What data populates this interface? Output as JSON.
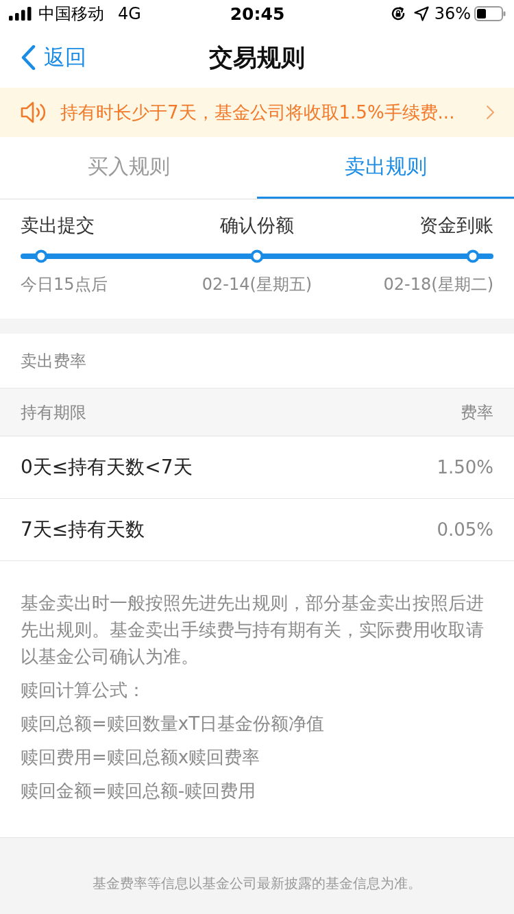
{
  "status_bar": {
    "carrier": "中国移动",
    "network": "4G",
    "time": "20:45",
    "battery": "36%"
  },
  "nav": {
    "back": "返回",
    "title": "交易规则"
  },
  "notice": {
    "text": "持有时长少于7天，基金公司将收取1.5%手续费..."
  },
  "tabs": [
    {
      "label": "买入规则",
      "selected": false
    },
    {
      "label": "卖出规则",
      "selected": true
    }
  ],
  "timeline": {
    "steps": [
      {
        "label": "卖出提交",
        "date": "今日15点后"
      },
      {
        "label": "确认份额",
        "date": "02-14(星期五)"
      },
      {
        "label": "资金到账",
        "date": "02-18(星期二)"
      }
    ]
  },
  "fee_section": {
    "title": "卖出费率",
    "columns": [
      "持有期限",
      "费率"
    ],
    "rows": [
      {
        "period": "0天≤持有天数<7天",
        "rate": "1.50%"
      },
      {
        "period": "7天≤持有天数",
        "rate": "0.05%"
      }
    ]
  },
  "notes": [
    "基金卖出时一般按照先进先出规则，部分基金卖出按照后进先出规则。基金卖出手续费与持有期有关，实际费用收取请以基金公司确认为准。",
    "赎回计算公式：",
    "赎回总额=赎回数量xT日基金份额净值",
    "赎回费用=赎回总额x赎回费率",
    "赎回金额=赎回总额-赎回费用"
  ],
  "footer": "基金费率等信息以基金公司最新披露的基金信息为准。"
}
